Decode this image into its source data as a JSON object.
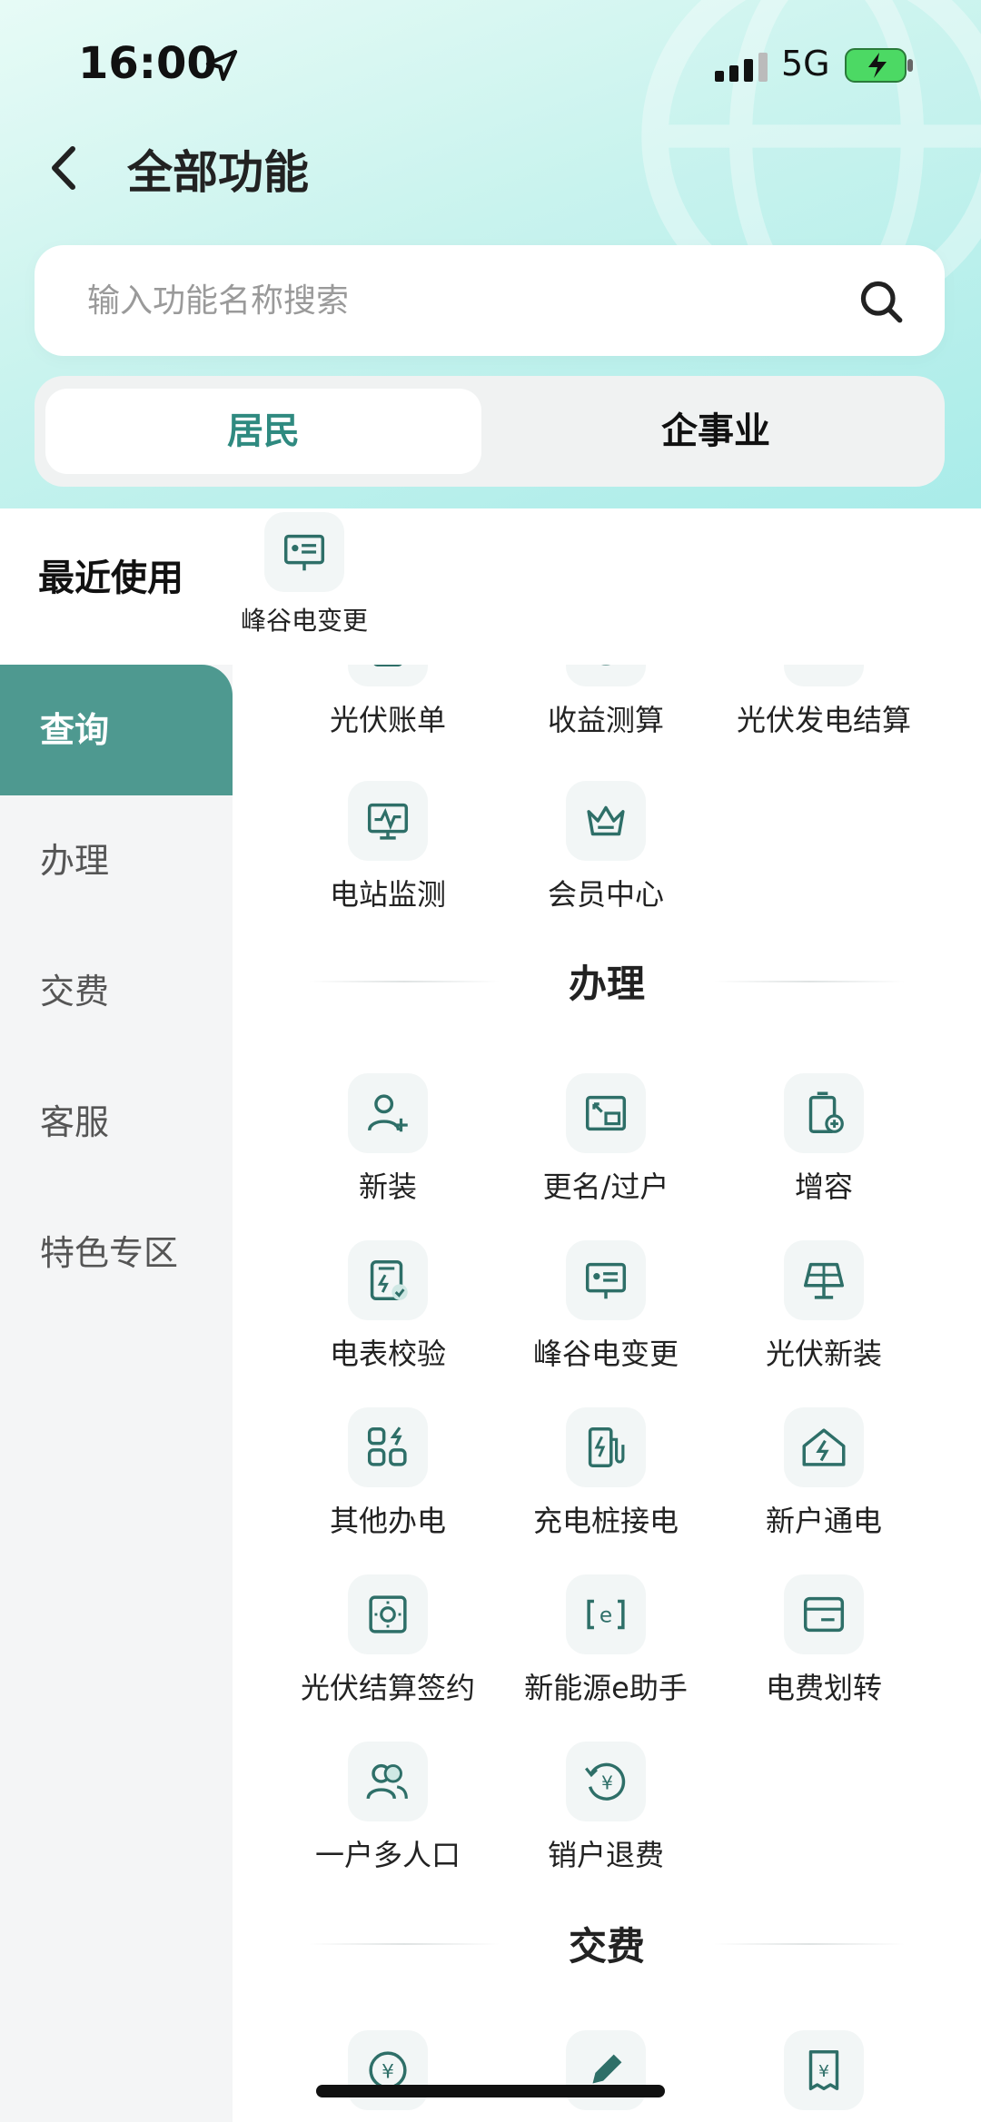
{
  "status_bar": {
    "time": "16:00",
    "network": "5G"
  },
  "header": {
    "title": "全部功能"
  },
  "search": {
    "placeholder": "输入功能名称搜索"
  },
  "segments": {
    "resident": "居民",
    "enterprise": "企事业"
  },
  "recent": {
    "label": "最近使用",
    "items": [
      {
        "label": "峰谷电变更",
        "icon": "display-icon"
      }
    ]
  },
  "sidebar": {
    "items": [
      {
        "label": "查询",
        "active": true
      },
      {
        "label": "办理"
      },
      {
        "label": "交费"
      },
      {
        "label": "客服"
      },
      {
        "label": "特色专区"
      }
    ]
  },
  "sections": {
    "query": {
      "items": [
        {
          "label": "光伏账单",
          "icon": "bill-icon"
        },
        {
          "label": "收益测算",
          "icon": "calc-icon"
        },
        {
          "label": "光伏发电结算",
          "icon": "settle-icon"
        },
        {
          "label": "电站监测",
          "icon": "monitor-icon"
        },
        {
          "label": "会员中心",
          "icon": "crown-icon"
        }
      ]
    },
    "handle": {
      "title": "办理",
      "items": [
        {
          "label": "新装",
          "icon": "add-user-icon"
        },
        {
          "label": "更名/过户",
          "icon": "transfer-icon"
        },
        {
          "label": "增容",
          "icon": "capacity-icon"
        },
        {
          "label": "电表校验",
          "icon": "meter-check-icon"
        },
        {
          "label": "峰谷电变更",
          "icon": "display-icon"
        },
        {
          "label": "光伏新装",
          "icon": "solar-panel-icon"
        },
        {
          "label": "其他办电",
          "icon": "grid-bolt-icon"
        },
        {
          "label": "充电桩接电",
          "icon": "charger-icon"
        },
        {
          "label": "新户通电",
          "icon": "house-bolt-icon"
        },
        {
          "label": "光伏结算签约",
          "icon": "sun-sign-icon"
        },
        {
          "label": "新能源e助手",
          "icon": "e-assistant-icon"
        },
        {
          "label": "电费划转",
          "icon": "card-transfer-icon"
        },
        {
          "label": "一户多人口",
          "icon": "multi-user-icon"
        },
        {
          "label": "销户退费",
          "icon": "refund-icon"
        }
      ]
    },
    "pay": {
      "title": "交费",
      "items": [
        {
          "label": "",
          "icon": "yuan-icon"
        },
        {
          "label": "",
          "icon": "pen-icon"
        },
        {
          "label": "",
          "icon": "invoice-icon"
        }
      ]
    }
  },
  "colors": {
    "accent": "#4e9990",
    "active_text": "#2f8a80",
    "icon_stroke": "#2e6f68"
  }
}
